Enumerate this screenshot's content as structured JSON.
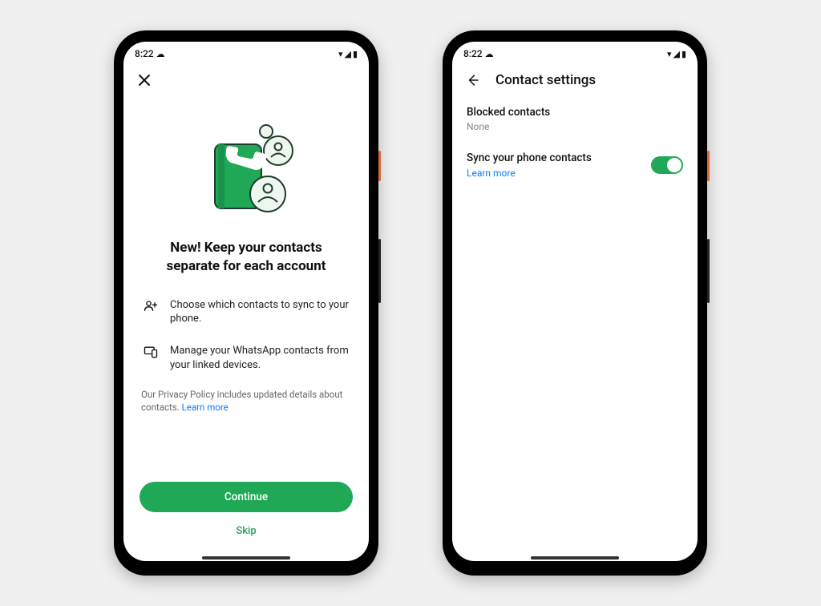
{
  "statusbar": {
    "time": "8:22"
  },
  "left": {
    "headline": "New! Keep your contacts separate for each account",
    "bullets": [
      "Choose which contacts to sync to your phone.",
      "Manage your WhatsApp contacts from your linked devices."
    ],
    "policy_prefix": "Our Privacy Policy includes updated details about contacts. ",
    "policy_link": "Learn more",
    "continue": "Continue",
    "skip": "Skip"
  },
  "right": {
    "title": "Contact settings",
    "blocked_label": "Blocked contacts",
    "blocked_value": "None",
    "sync_label": "Sync your phone contacts",
    "learn_more": "Learn more",
    "sync_on": true
  },
  "colors": {
    "accent": "#1fa855",
    "link": "#0a7cff"
  }
}
